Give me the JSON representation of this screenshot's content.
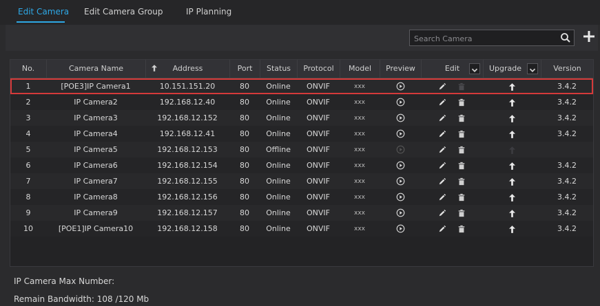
{
  "tabs": [
    {
      "label": "Edit Camera",
      "active": true
    },
    {
      "label": "Edit Camera Group",
      "active": false
    },
    {
      "label": "IP Planning",
      "active": false
    }
  ],
  "search": {
    "placeholder": "Search Camera"
  },
  "columns": [
    "No.",
    "Camera Name",
    "Address",
    "Port",
    "Status",
    "Protocol",
    "Model",
    "Preview",
    "Edit",
    "Upgrade",
    "Version"
  ],
  "rows": [
    {
      "no": "1",
      "name": "[POE3]IP Camera1",
      "address": "10.151.151.20",
      "port": "80",
      "status": "Online",
      "protocol": "ONVIF",
      "model": "xxx",
      "version": "3.4.2",
      "online": true
    },
    {
      "no": "2",
      "name": "IP Camera2",
      "address": "192.168.12.40",
      "port": "80",
      "status": "Online",
      "protocol": "ONVIF",
      "model": "xxx",
      "version": "3.4.2",
      "online": true
    },
    {
      "no": "3",
      "name": "IP Camera3",
      "address": "192.168.12.152",
      "port": "80",
      "status": "Online",
      "protocol": "ONVIF",
      "model": "xxx",
      "version": "3.4.2",
      "online": true
    },
    {
      "no": "4",
      "name": "IP Camera4",
      "address": "192.168.12.41",
      "port": "80",
      "status": "Online",
      "protocol": "ONVIF",
      "model": "xxx",
      "version": "3.4.2",
      "online": true
    },
    {
      "no": "5",
      "name": "IP Camera5",
      "address": "192.168.12.153",
      "port": "80",
      "status": "Offline",
      "protocol": "ONVIF",
      "model": "xxx",
      "version": "",
      "online": false
    },
    {
      "no": "6",
      "name": "IP Camera6",
      "address": "192.168.12.154",
      "port": "80",
      "status": "Online",
      "protocol": "ONVIF",
      "model": "xxx",
      "version": "3.4.2",
      "online": true
    },
    {
      "no": "7",
      "name": "IP Camera7",
      "address": "192.168.12.155",
      "port": "80",
      "status": "Online",
      "protocol": "ONVIF",
      "model": "xxx",
      "version": "3.4.2",
      "online": true
    },
    {
      "no": "8",
      "name": "IP Camera8",
      "address": "192.168.12.156",
      "port": "80",
      "status": "Online",
      "protocol": "ONVIF",
      "model": "xxx",
      "version": "3.4.2",
      "online": true
    },
    {
      "no": "9",
      "name": "IP Camera9",
      "address": "192.168.12.157",
      "port": "80",
      "status": "Online",
      "protocol": "ONVIF",
      "model": "xxx",
      "version": "3.4.2",
      "online": true
    },
    {
      "no": "10",
      "name": "[POE1]IP Camera10",
      "address": "192.168.12.158",
      "port": "80",
      "status": "Online",
      "protocol": "ONVIF",
      "model": "xxx",
      "version": "3.4.2",
      "online": true
    }
  ],
  "footer": {
    "max_number": "IP Camera Max Number:",
    "bandwidth": "Remain Bandwidth: 108 /120 Mb"
  },
  "colors": {
    "accent": "#2ea8e6",
    "highlight": "#d63a3a"
  },
  "icons": {
    "search": "search-icon",
    "add": "plus-icon",
    "preview": "play-icon",
    "edit": "pencil-icon",
    "delete": "trash-icon",
    "upgrade": "arrow-up-icon",
    "sort": "sort-arrow-icon",
    "dropdown": "chevron-down-icon"
  }
}
